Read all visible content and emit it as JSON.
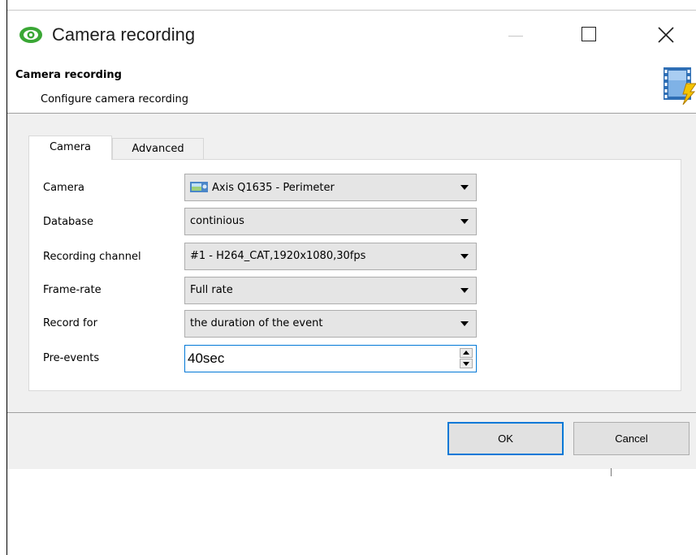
{
  "window": {
    "title": "Camera recording"
  },
  "header": {
    "title": "Camera recording",
    "subtitle": "Configure camera recording"
  },
  "tabs": [
    {
      "label": "Camera",
      "selected": true
    },
    {
      "label": "Advanced",
      "selected": false
    }
  ],
  "form": {
    "camera": {
      "label": "Camera",
      "value": "Axis Q1635 - Perimeter",
      "icon": "camera-icon"
    },
    "database": {
      "label": "Database",
      "value": "continious"
    },
    "recording_channel": {
      "label": "Recording channel",
      "value": "#1 - H264_CAT,1920x1080,30fps"
    },
    "frame_rate": {
      "label": "Frame-rate",
      "value": "Full rate"
    },
    "record_for": {
      "label": "Record for",
      "value": "the duration of the event"
    },
    "pre_events": {
      "label": "Pre-events",
      "value": "40sec"
    }
  },
  "buttons": {
    "ok": "OK",
    "cancel": "Cancel"
  },
  "colors": {
    "accent": "#0078d7",
    "app_icon_green": "#3aa735",
    "window_bg": "#f0f0f0"
  }
}
